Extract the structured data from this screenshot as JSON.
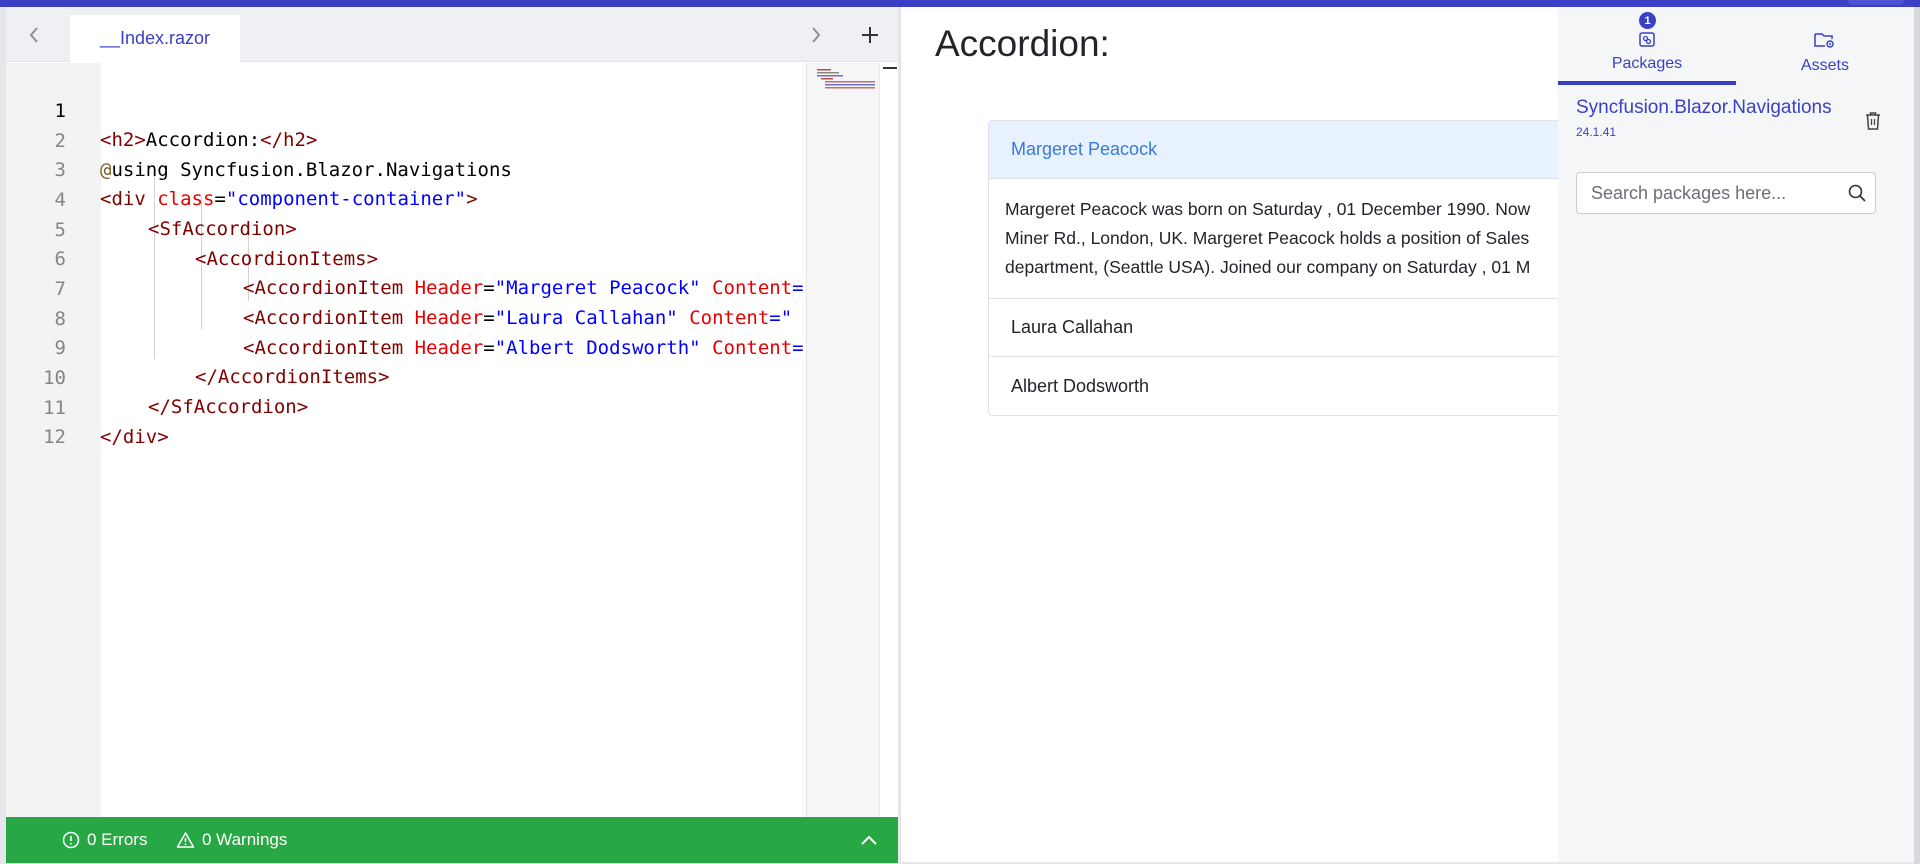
{
  "editor": {
    "tab_label": "__Index.razor",
    "nav_prev_icon": "chevron-left-icon",
    "nav_next_icon": "chevron-right-icon",
    "add_icon": "plus-icon",
    "lines": [
      {
        "n": "1"
      },
      {
        "n": "2"
      },
      {
        "n": "3"
      },
      {
        "n": "4"
      },
      {
        "n": "5"
      },
      {
        "n": "6"
      },
      {
        "n": "7"
      },
      {
        "n": "8"
      },
      {
        "n": "9"
      },
      {
        "n": "10"
      },
      {
        "n": "11"
      },
      {
        "n": "12"
      }
    ],
    "code": {
      "l1_open": "<h2>",
      "l1_text": "Accordion:",
      "l1_close": "</h2>",
      "l2_at": "@",
      "l2_text": "using Syncfusion.Blazor.Navigations",
      "l3_open": "<div",
      "l3_attr": "class",
      "l3_eq": "=",
      "l3_val": "\"component-container\"",
      "l3_end": ">",
      "l4": "<SfAccordion>",
      "l5": "<AccordionItems>",
      "l6_tag": "<AccordionItem",
      "l6_attr": "Header",
      "l6_val": "\"Margeret Peacock\"",
      "l6_attr2": "Content",
      "l6_rest": "=\"",
      "l7_tag": "<AccordionItem",
      "l7_attr": "Header",
      "l7_val": "\"Laura Callahan\"",
      "l7_attr2": "Content",
      "l7_rest": "=\"",
      "l8_tag": "<AccordionItem",
      "l8_attr": "Header",
      "l8_val": "\"Albert Dodsworth\"",
      "l8_attr2": "Content",
      "l8_rest": "=\"",
      "l9": "</AccordionItems>",
      "l10": "</SfAccordion>",
      "l11": "</div>"
    }
  },
  "status": {
    "errors": "0 Errors",
    "warnings": "0 Warnings",
    "bg": "#28a745"
  },
  "preview": {
    "heading": "Accordion:",
    "items": [
      {
        "header": "Margeret Peacock",
        "expanded": true,
        "content_lines": [
          "Margeret Peacock was born on Saturday , 01 December 1990. Now",
          "Miner Rd., London, UK. Margeret Peacock holds a position of Sales",
          "department, (Seattle USA). Joined our company on Saturday , 01 M"
        ]
      },
      {
        "header": "Laura Callahan",
        "expanded": false
      },
      {
        "header": "Albert Dodsworth",
        "expanded": false
      }
    ]
  },
  "side_panel": {
    "tabs": {
      "packages": "Packages",
      "assets": "Assets"
    },
    "packages_badge": "1",
    "package": {
      "name": "Syncfusion.Blazor.Navigations",
      "version": "24.1.41"
    },
    "search": {
      "placeholder": "Search packages here...",
      "value": ""
    }
  },
  "colors": {
    "accent": "#3b3fc4",
    "status_green": "#28a745",
    "accordion_active_bg": "#e7f1ff",
    "accordion_active_text": "#3a7bd5"
  }
}
